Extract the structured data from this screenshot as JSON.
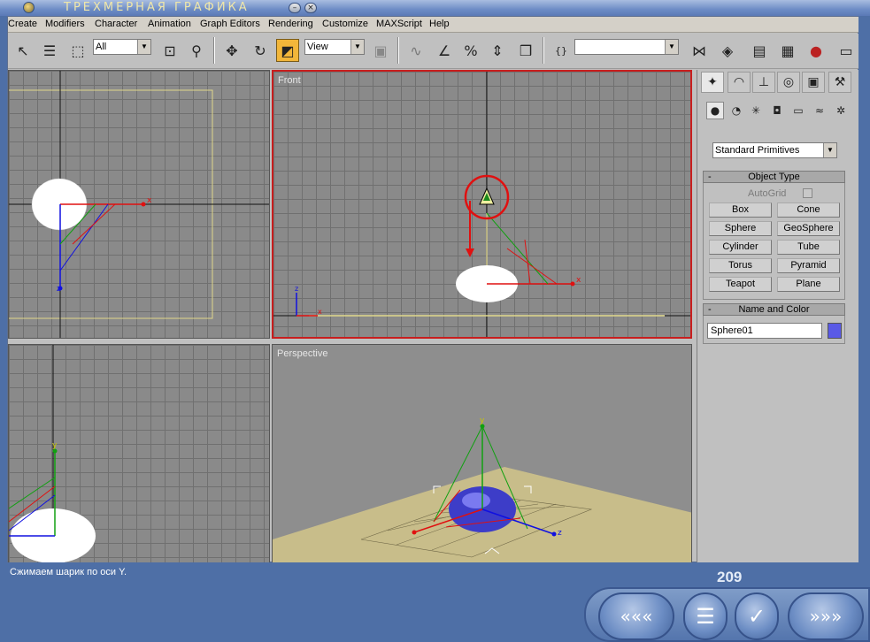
{
  "window": {
    "title": "ТРЕХМЕРНАЯ ГРАФИКА"
  },
  "menu": [
    "Create",
    "Modifiers",
    "Character",
    "Animation",
    "Graph Editors",
    "Rendering",
    "Customize",
    "MAXScript",
    "Help"
  ],
  "toolbar": {
    "selection_filter": "All",
    "reference_coord": "View",
    "named_selection": ""
  },
  "viewports": {
    "front_label": "Front",
    "perspective_label": "Perspective"
  },
  "axis_labels": {
    "x": "x",
    "y": "y",
    "z": "z"
  },
  "command_panel": {
    "category": "Standard Primitives",
    "object_type": {
      "title": "Object Type",
      "minus": "-",
      "autogrid": "AutoGrid",
      "buttons": [
        "Box",
        "Cone",
        "Sphere",
        "GeoSphere",
        "Cylinder",
        "Tube",
        "Torus",
        "Pyramid",
        "Teapot",
        "Plane"
      ]
    },
    "name_color": {
      "title": "Name and Color",
      "minus": "-",
      "name": "Sphere01",
      "color": "#5a5ae6"
    }
  },
  "status": {
    "message": "Сжимаем шарик по оси Y.",
    "page": "209"
  },
  "nav": {
    "prev": "«««",
    "menu": "☰",
    "check": "✓",
    "next": "»»»"
  },
  "colors": {
    "viewport_active_border": "#c81e1e",
    "grid_bg": "#8a8a8a",
    "frame_blue": "#4e6fa6"
  }
}
